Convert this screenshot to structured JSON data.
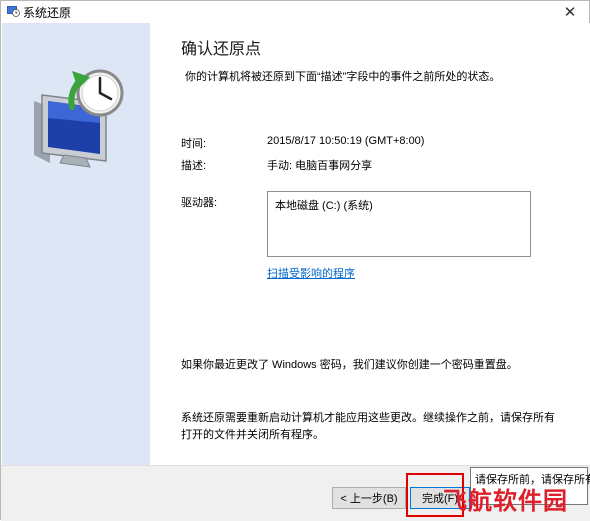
{
  "window": {
    "title": "系统还原",
    "close_glyph": "✕"
  },
  "page": {
    "heading": "确认还原点",
    "description": "你的计算机将被还原到下面“描述”字段中的事件之前所处的状态。",
    "time_label": "时间:",
    "time_value": "2015/8/17 10:50:19 (GMT+8:00)",
    "desc_label": "描述:",
    "desc_value": "手动: 电脑百事网分享",
    "drives_label": "驱动器:",
    "drives": [
      "本地磁盘 (C:) (系统)"
    ],
    "scan_link": "扫描受影响的程序",
    "password_notice": "如果你最近更改了 Windows 密码，我们建议你创建一个密码重置盘。",
    "restart_notice": "系统还原需要重新启动计算机才能应用这些更改。继续操作之前，请保存所有打开的文件并关闭所有程序。"
  },
  "footer": {
    "back_button": "< 上一步(B)",
    "finish_button": "完成(F)"
  },
  "tooltip": {
    "text": "请保存所前，请保存所有"
  },
  "watermark": "飞航软件园",
  "colors": {
    "sidebar": "#dce6f4",
    "link": "#0066cc",
    "highlight": "#e00000",
    "watermark": "#dc1f2b"
  }
}
